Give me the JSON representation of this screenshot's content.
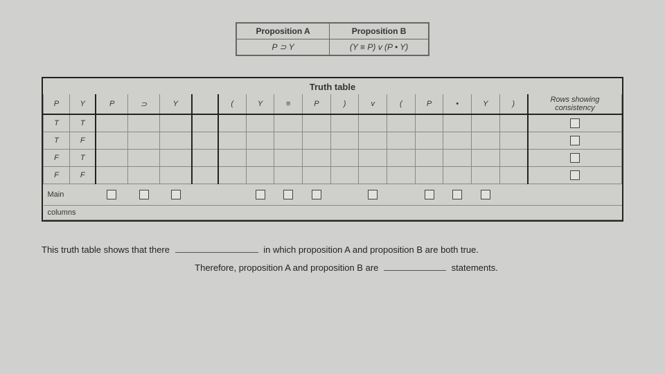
{
  "propositions": {
    "header_a": "Proposition A",
    "header_b": "Proposition B",
    "expr_a": "P ⊃ Y",
    "expr_b": "(Y ≡ P) v (P • Y)"
  },
  "truth_table": {
    "title": "Truth table",
    "rows_showing": "Rows showing",
    "consistency": "consistency",
    "headers_py": [
      "P",
      "Y"
    ],
    "headers_a": [
      "P",
      "⊃",
      "Y"
    ],
    "gap": "",
    "headers_b": [
      "(",
      "Y",
      "≡",
      "P",
      ")",
      "v",
      "(",
      "P",
      "•",
      "Y",
      ")"
    ],
    "rows": [
      {
        "p": "T",
        "y": "T"
      },
      {
        "p": "T",
        "y": "F"
      },
      {
        "p": "F",
        "y": "T"
      },
      {
        "p": "F",
        "y": "F"
      }
    ],
    "main_label": "Main",
    "columns_label": "columns"
  },
  "sentences": {
    "s1a": "This truth table shows that there",
    "s1b": "in which proposition A and proposition B are both true.",
    "s2a": "Therefore, proposition A and proposition B are",
    "s2b": "statements."
  }
}
